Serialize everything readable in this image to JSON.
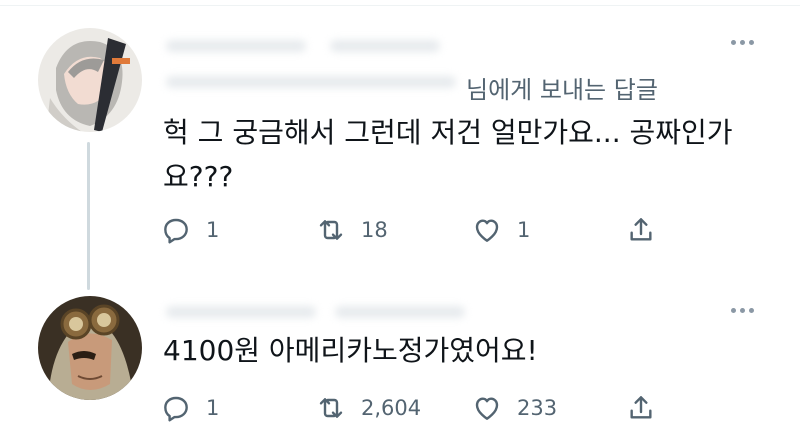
{
  "reply_context": {
    "text": "님에게 보내는 답글"
  },
  "tweets": [
    {
      "text": "헉 그 궁금해서 그런데 저건 얼만가요... 공짜인가요???",
      "actions": {
        "reply": "1",
        "retweet": "18",
        "like": "1"
      }
    },
    {
      "text": "4100원 아메리카노정가였어요!",
      "actions": {
        "reply": "1",
        "retweet": "2,604",
        "like": "233"
      }
    }
  ],
  "icons": {
    "reply": "reply-icon",
    "retweet": "retweet-icon",
    "like": "heart-icon",
    "share": "share-icon",
    "more": "more-icon"
  },
  "colors": {
    "text": "#0f1419",
    "secondary": "#536471",
    "thread_line": "#cfd9de"
  }
}
